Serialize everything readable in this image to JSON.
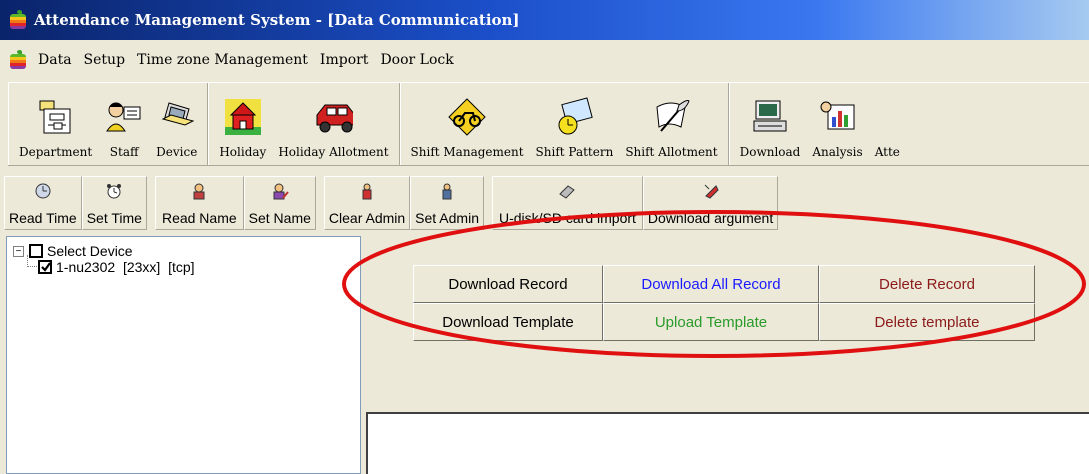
{
  "window": {
    "title": "Attendance Management System - [Data Communication]"
  },
  "menu": [
    "Data",
    "Setup",
    "Time zone Management",
    "Import",
    "Door Lock"
  ],
  "toolbar": {
    "groups": [
      [
        {
          "label": "Department",
          "icon": "department-icon"
        },
        {
          "label": "Staff",
          "icon": "staff-icon"
        },
        {
          "label": "Device",
          "icon": "device-icon"
        }
      ],
      [
        {
          "label": "Holiday",
          "icon": "holiday-icon"
        },
        {
          "label": "Holiday Allotment",
          "icon": "car-icon"
        }
      ],
      [
        {
          "label": "Shift Management",
          "icon": "bicycle-icon"
        },
        {
          "label": "Shift Pattern",
          "icon": "shift-pattern-icon"
        },
        {
          "label": "Shift Allotment",
          "icon": "quill-icon"
        }
      ],
      [
        {
          "label": "Download",
          "icon": "computer-icon"
        },
        {
          "label": "Analysis",
          "icon": "analysis-icon"
        },
        {
          "label": "Atte",
          "icon": ""
        }
      ]
    ]
  },
  "subtoolbar": {
    "groups": [
      [
        "Read Time",
        "Set Time"
      ],
      [
        "Read Name",
        "Set Name"
      ],
      [
        "Clear Admin",
        "Set Admin"
      ],
      [
        "U-disk/SD card import",
        "Download argument"
      ]
    ]
  },
  "device_tree": {
    "root_label": "Select Device",
    "device_label": "1-nu2302  [23xx]  [tcp]",
    "device_checked": true
  },
  "commands": {
    "download_record": "Download Record",
    "download_all_record": "Download All Record",
    "delete_record": "Delete Record",
    "download_template": "Download Template",
    "upload_template": "Upload Template",
    "delete_template": "Delete template"
  },
  "colors": {
    "download_all_record": "#1a1aff",
    "upload_template": "#2a9a2a",
    "delete": "#8b1a1a",
    "annotation": "#e01010"
  }
}
